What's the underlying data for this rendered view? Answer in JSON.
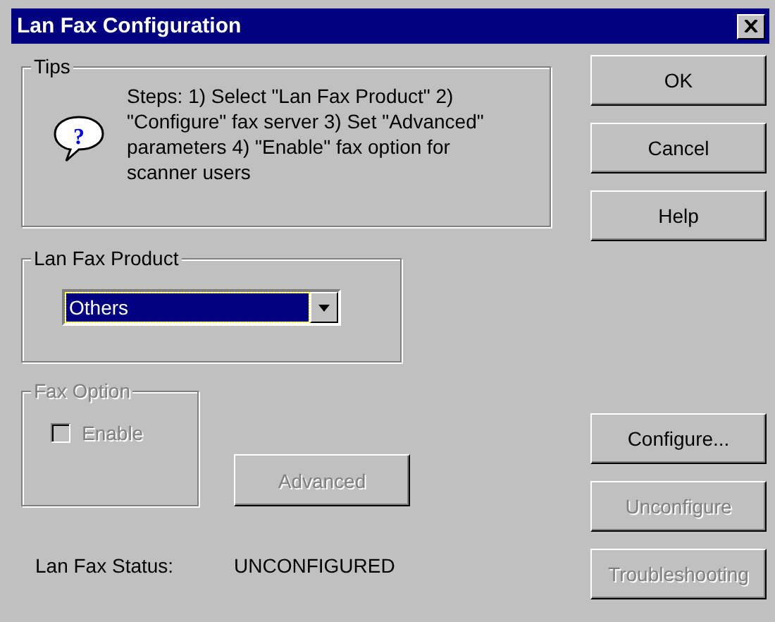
{
  "window": {
    "title": "Lan Fax Configuration"
  },
  "tips": {
    "label": "Tips",
    "icon_glyph": "?",
    "text": "Steps: 1) Select \"Lan Fax Product\"  2) \"Configure\" fax server 3) Set \"Advanced\" parameters 4) \"Enable\" fax option for scanner users"
  },
  "product": {
    "label": "Lan Fax Product",
    "dropdown": {
      "value": "Others"
    }
  },
  "fax_option": {
    "label": "Fax Option",
    "disabled": true,
    "checkbox": {
      "label": "Enable",
      "checked": false,
      "disabled": true
    }
  },
  "advanced_button": {
    "label": "Advanced",
    "disabled": true
  },
  "status": {
    "label": "Lan Fax Status:",
    "value": "UNCONFIGURED"
  },
  "top_buttons": [
    {
      "label": "OK",
      "disabled": false
    },
    {
      "label": "Cancel",
      "disabled": false
    },
    {
      "label": "Help",
      "disabled": false
    }
  ],
  "bottom_buttons": [
    {
      "label": "Configure...",
      "disabled": false
    },
    {
      "label": "Unconfigure",
      "disabled": true
    },
    {
      "label": "Troubleshooting",
      "disabled": true
    }
  ]
}
